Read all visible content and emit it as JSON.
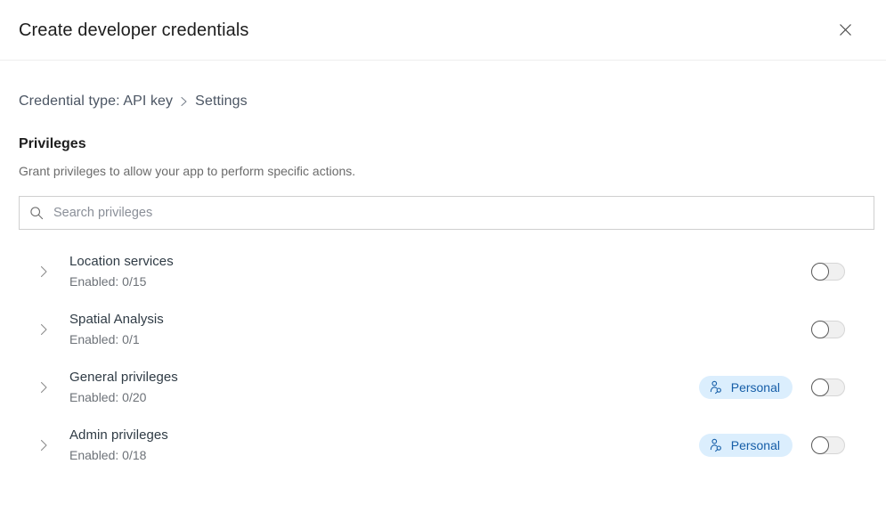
{
  "header": {
    "title": "Create developer credentials",
    "close_icon": "close-icon"
  },
  "breadcrumb": {
    "items": [
      {
        "label": "Credential type: API key"
      },
      {
        "label": "Settings"
      }
    ],
    "separator": "›"
  },
  "section": {
    "title": "Privileges",
    "description": "Grant privileges to allow your app to perform specific actions."
  },
  "search": {
    "placeholder": "Search privileges",
    "value": "",
    "icon": "search-icon"
  },
  "privileges": {
    "rows": [
      {
        "name": "Location services",
        "enabled_label": "Enabled: 0/15",
        "chip": null,
        "toggle_on": false,
        "expand_icon": "chevron-right-icon"
      },
      {
        "name": "Spatial Analysis",
        "enabled_label": "Enabled: 0/1",
        "chip": null,
        "toggle_on": false,
        "expand_icon": "chevron-right-icon"
      },
      {
        "name": "General privileges",
        "enabled_label": "Enabled: 0/20",
        "chip": "Personal",
        "toggle_on": false,
        "expand_icon": "chevron-right-icon"
      },
      {
        "name": "Admin privileges",
        "enabled_label": "Enabled: 0/18",
        "chip": "Personal",
        "toggle_on": false,
        "expand_icon": "chevron-right-icon"
      }
    ]
  },
  "colors": {
    "chip_background": "#dbeefd",
    "chip_text": "#165ea8",
    "border": "#cfcfcf",
    "heading": "#1d1d1d",
    "muted_text": "#6b6b6b"
  }
}
